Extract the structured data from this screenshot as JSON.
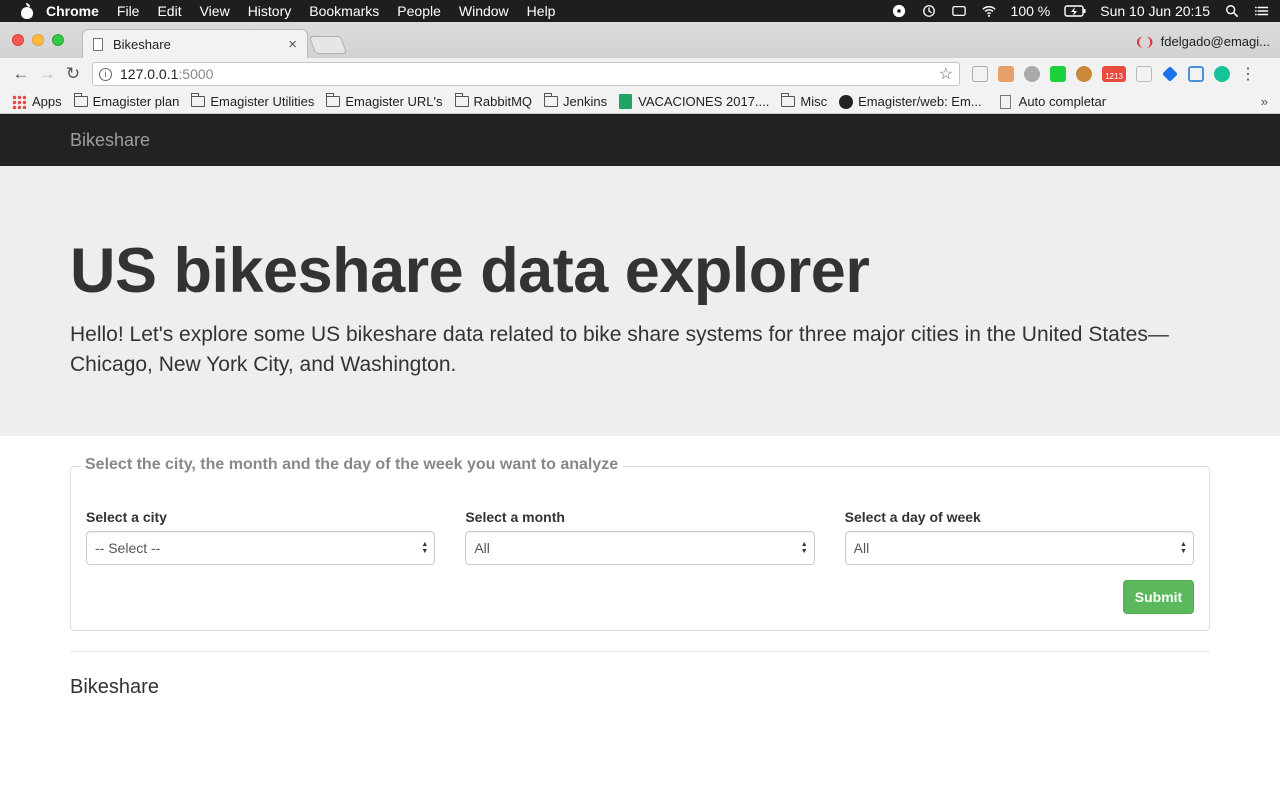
{
  "menubar": {
    "items": [
      "Chrome",
      "File",
      "Edit",
      "View",
      "History",
      "Bookmarks",
      "People",
      "Window",
      "Help"
    ],
    "battery": "100 %",
    "clock": "Sun 10 Jun  20:15"
  },
  "browser": {
    "tab_title": "Bikeshare",
    "tab_close": "×",
    "profile": "fdelgado@emagi...",
    "url_host": "127.0.0.1",
    "url_port": ":5000",
    "bookmarks": [
      "Apps",
      "Emagister plan",
      "Emagister Utilities",
      "Emagister URL's",
      "RabbitMQ",
      "Jenkins",
      "VACACIONES 2017....",
      "Misc",
      "Emagister/web: Em...",
      "Auto completar"
    ],
    "bookmarks_more": "»",
    "ext_badge": "1213"
  },
  "page": {
    "brand": "Bikeshare",
    "heading": "US bikeshare data explorer",
    "intro": "Hello! Let's explore some US bikeshare data related to bike share systems for three major cities in the United States—Chicago, New York City, and Washington.",
    "form": {
      "legend": "Select the city, the month and the day of the week you want to analyze",
      "city_label": "Select a city",
      "city_value": "-- Select --",
      "month_label": "Select a month",
      "month_value": "All",
      "day_label": "Select a day of week",
      "day_value": "All",
      "submit_label": "Submit"
    },
    "footer_brand": "Bikeshare"
  },
  "colors": {
    "navbar": "#222222",
    "jumbotron": "#eeeeee",
    "submit": "#5cb85c"
  }
}
